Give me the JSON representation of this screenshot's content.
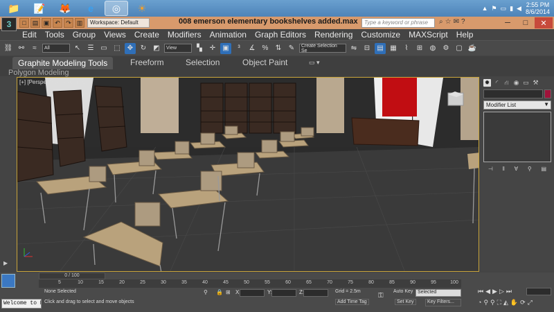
{
  "taskbar": {
    "items": [
      {
        "name": "file-explorer-icon",
        "glyph": "📁"
      },
      {
        "name": "notepad-icon",
        "glyph": "📝"
      },
      {
        "name": "firefox-icon",
        "glyph": "🦊"
      },
      {
        "name": "internet-explorer-icon",
        "glyph": "e"
      },
      {
        "name": "3dsmax-icon",
        "glyph": "◎"
      },
      {
        "name": "app-icon",
        "glyph": "☀"
      }
    ],
    "time": "2:55 PM",
    "date": "8/6/2014"
  },
  "titlebar": {
    "logo": "3",
    "workspace": "Workspace: Default",
    "title": "008 emerson elementary  bookshelves added.max",
    "search_placeholder": "Type a keyword or phrase"
  },
  "menu": [
    "Edit",
    "Tools",
    "Group",
    "Views",
    "Create",
    "Modifiers",
    "Animation",
    "Graph Editors",
    "Rendering",
    "Customize",
    "MAXScript",
    "Help"
  ],
  "toolbar": {
    "filter": "All",
    "refcoord": "View",
    "selection_set": "Create Selection Se"
  },
  "ribbon": {
    "tabs": [
      "Graphite Modeling Tools",
      "Freeform",
      "Selection",
      "Object Paint"
    ],
    "sub": "Polygon Modeling"
  },
  "viewport": {
    "label": "[+] [Perspective ] [Realistic ]"
  },
  "command_panel": {
    "modifier_list": "Modifier List",
    "accent": "#a0133a"
  },
  "timeline": {
    "slider": "0 / 100",
    "ticks": [
      "5",
      "10",
      "15",
      "20",
      "25",
      "30",
      "35",
      "40",
      "45",
      "50",
      "55",
      "60",
      "65",
      "70",
      "75",
      "80",
      "85",
      "90",
      "95",
      "100"
    ]
  },
  "status": {
    "selection": "None Selected",
    "prompt": "Click and drag to select and move objects",
    "listener": "Welcome to M",
    "x_label": "X:",
    "y_label": "Y:",
    "z_label": "Z:",
    "grid": "Grid = 2.5m",
    "add_time_tag": "Add Time Tag",
    "auto_key": "Auto Key",
    "selected": "Selected",
    "set_key": "Set Key",
    "key_filters": "Key Filters..."
  }
}
